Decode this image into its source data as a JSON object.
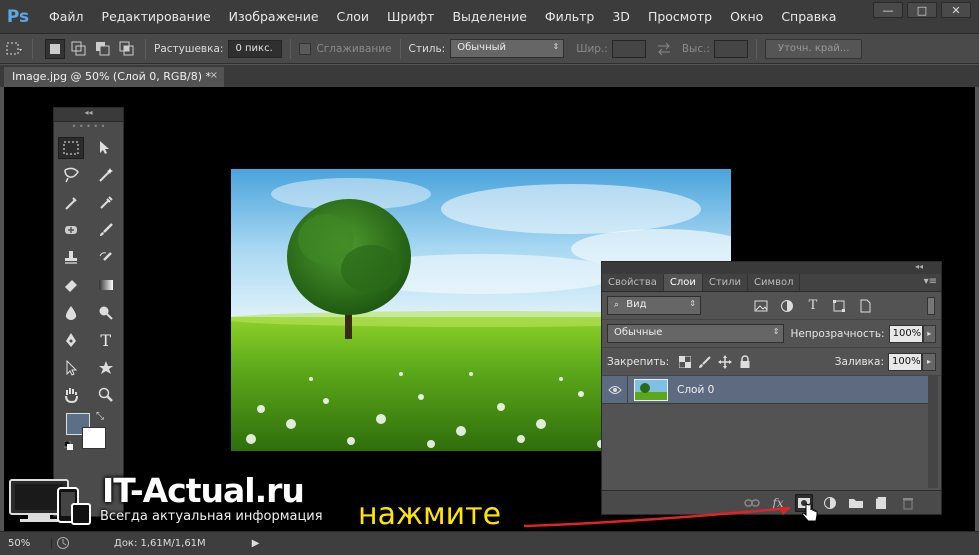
{
  "app": {
    "logo": "Ps"
  },
  "menu": [
    "Файл",
    "Редактирование",
    "Изображение",
    "Слои",
    "Шрифт",
    "Выделение",
    "Фильтр",
    "3D",
    "Просмотр",
    "Окно",
    "Справка"
  ],
  "window_controls": [
    "—",
    "□",
    "✕"
  ],
  "options_bar": {
    "feather_label": "Растушевка:",
    "feather_value": "0 пикс.",
    "antialias_label": "Сглаживание",
    "style_label": "Стиль:",
    "style_value": "Обычный",
    "width_label": "Шир.:",
    "height_label": "Выс.:",
    "refine_edge": "Уточн. край..."
  },
  "document": {
    "tab_title": "Image.jpg @ 50% (Слой 0, RGB/8) *",
    "close": "×"
  },
  "tools_panel": {
    "header": "◂◂",
    "close": "×"
  },
  "layers_panel": {
    "tabs": [
      "Свойства",
      "Слои",
      "Стили",
      "Символ"
    ],
    "active_tab": "Слои",
    "collapse": "◂◂",
    "filter_kind": "Вид",
    "blend_mode": "Обычные",
    "opacity_label": "Непрозрачность:",
    "opacity_value": "100%",
    "lock_label": "Закрепить:",
    "fill_label": "Заливка:",
    "fill_value": "100%",
    "layer_name": "Слой 0"
  },
  "status_bar": {
    "zoom": "50%",
    "doc_info": "Док: 1,61M/1,61M"
  },
  "watermark": {
    "title": "IT-Actual.ru",
    "subtitle": "Всегда актуальная информация"
  },
  "callout": {
    "text": "нажмите"
  },
  "colors": {
    "accent": "#5ea8e8",
    "callout": "#ffe600",
    "arrow": "#e0222a",
    "layer_selected": "#5e6a80"
  }
}
